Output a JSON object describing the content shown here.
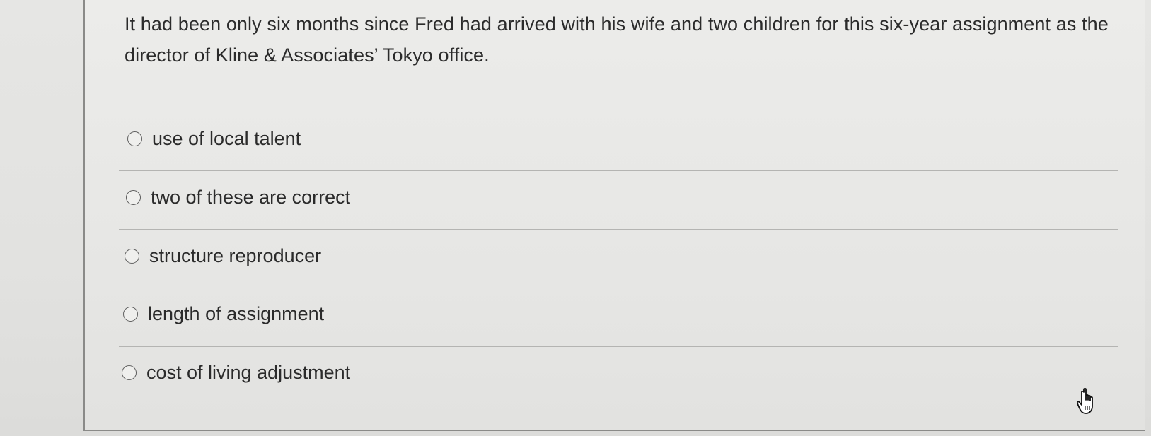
{
  "question": {
    "text": "It had been only six months since Fred had arrived with his wife and two children for this six-year assignment as the director of Kline & Associates’ Tokyo office."
  },
  "options": [
    {
      "label": "use of local talent",
      "selected": false
    },
    {
      "label": "two of these are correct",
      "selected": false
    },
    {
      "label": "structure reproducer",
      "selected": false
    },
    {
      "label": "length of assignment",
      "selected": false
    },
    {
      "label": "cost of living adjustment",
      "selected": false
    }
  ],
  "cursor": {
    "icon": "hand-pointer-icon"
  }
}
